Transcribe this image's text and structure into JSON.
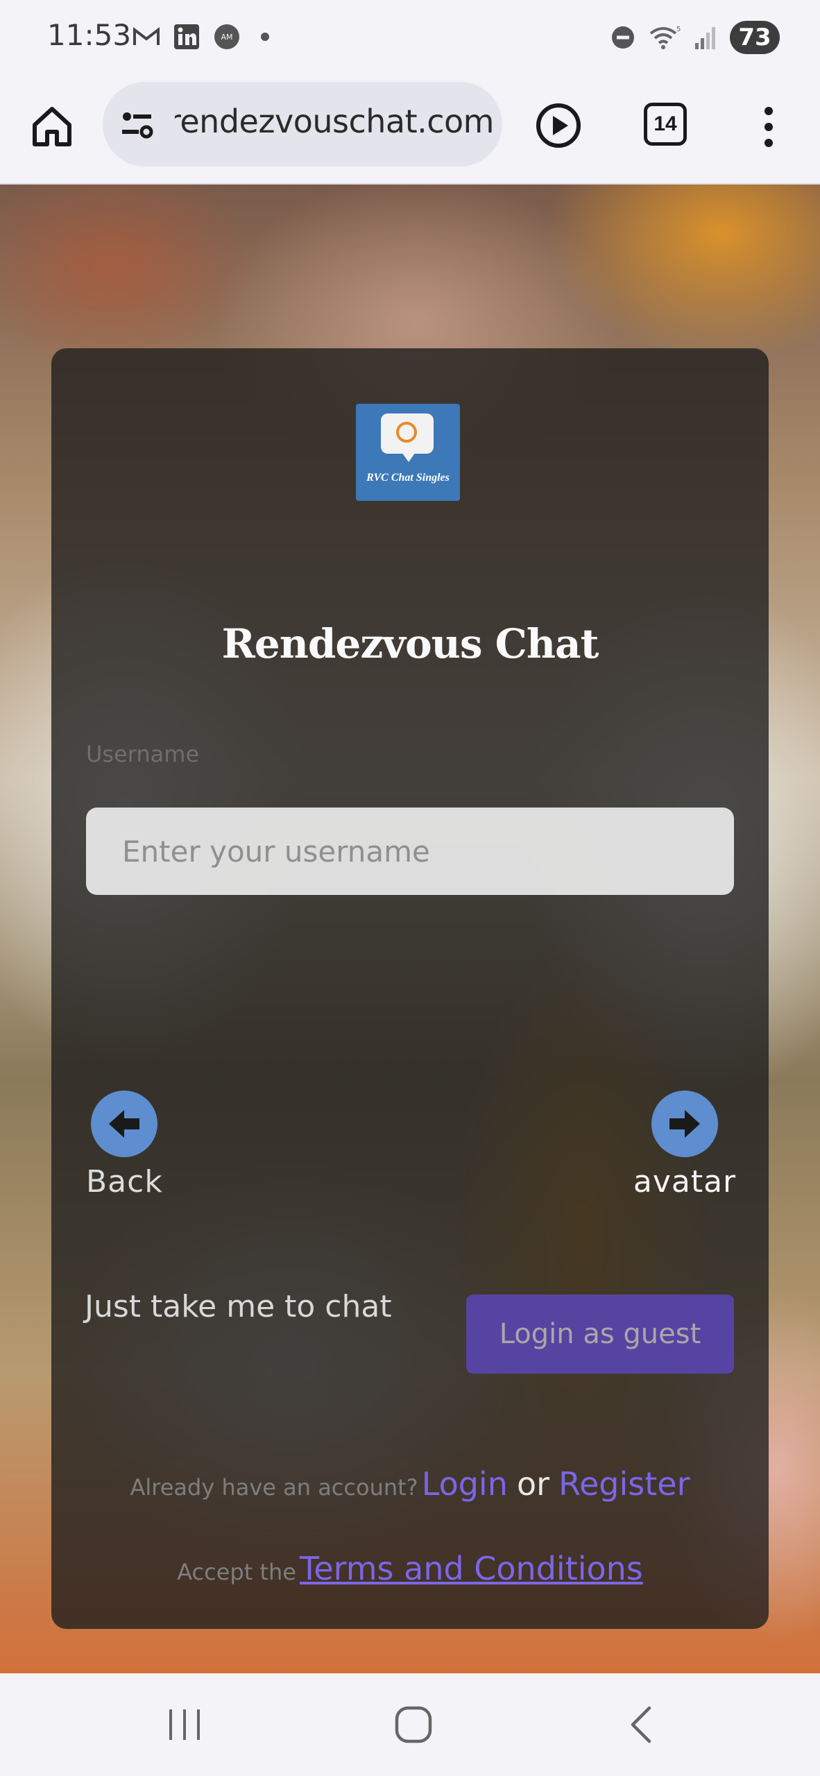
{
  "status_bar": {
    "time": "11:53",
    "icons": [
      "gmail-icon",
      "linkedin-icon",
      "amex-icon"
    ],
    "battery": "73"
  },
  "browser": {
    "url": "rendezvouschat.com",
    "tab_count": "14"
  },
  "card": {
    "logo_text": "RVC Chat Singles",
    "title": "Rendezvous Chat",
    "username_label": "Username",
    "username_placeholder": "Enter your username",
    "username_value": "",
    "back_label": "Back",
    "next_label": "avatar",
    "guest_prompt": "Just take me to chat",
    "guest_button": "Login as guest",
    "account_prompt": "Already have an account?",
    "login_link": "Login",
    "or_text": "or",
    "register_link": "Register",
    "terms_prompt": "Accept the",
    "terms_link": "Terms and Conditions"
  },
  "colors": {
    "accent": "#7b66e8",
    "guest_button": "#5c48c4",
    "nav_circle": "#5e8ed0",
    "card_bg": "#1e1e1e"
  }
}
